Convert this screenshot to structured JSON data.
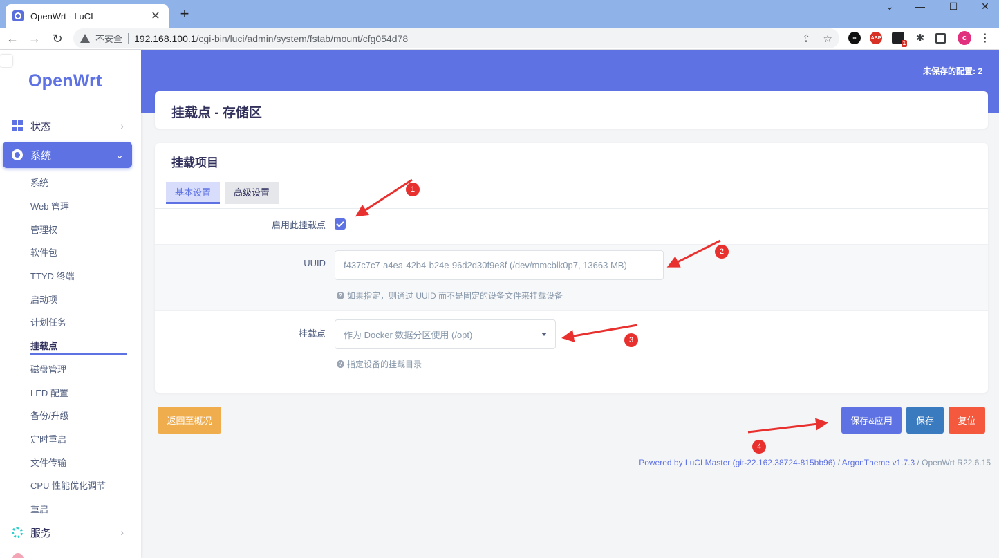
{
  "browser": {
    "tab_title": "OpenWrt - LuCI",
    "insecure_label": "不安全",
    "url_host": "192.168.100.1",
    "url_path": "/cgi-bin/luci/admin/system/fstab/mount/cfg054d78",
    "ext_abp": "ABP",
    "ext_badge": "1",
    "profile_initial": "c"
  },
  "sidebar": {
    "brand": "OpenWrt",
    "status_label": "状态",
    "system_label": "系统",
    "services_label": "服务",
    "sub_items": [
      "系统",
      "Web 管理",
      "管理权",
      "软件包",
      "TTYD 终端",
      "启动项",
      "计划任务",
      "挂载点",
      "磁盘管理",
      "LED 配置",
      "备份/升级",
      "定时重启",
      "文件传输",
      "CPU 性能优化调节",
      "重启"
    ],
    "active_sub": "挂载点"
  },
  "header": {
    "unsaved": "未保存的配置: 2"
  },
  "page": {
    "title": "挂载点 - 存储区",
    "section_title": "挂载项目",
    "tab_basic": "基本设置",
    "tab_advanced": "高级设置",
    "enable_label": "启用此挂载点",
    "enable_checked": true,
    "uuid_label": "UUID",
    "uuid_value": "f437c7c7-a4ea-42b4-b24e-96d2d30f9e8f (/dev/mmcblk0p7, 13663 MB)",
    "uuid_hint": "如果指定，则通过 UUID 而不是固定的设备文件来挂载设备",
    "mount_label": "挂载点",
    "mount_value": "作为 Docker 数据分区使用 (/opt)",
    "mount_hint": "指定设备的挂载目录"
  },
  "actions": {
    "back": "返回至概况",
    "save_apply": "保存&应用",
    "save": "保存",
    "reset": "复位"
  },
  "footer": {
    "powered": "Powered by LuCI Master (git-22.162.38724-815bb96)",
    "sep1": " / ",
    "theme": "ArgonTheme v1.7.3",
    "sep2": " / ",
    "release": "OpenWrt R22.6.15"
  },
  "annotations": [
    "1",
    "2",
    "3",
    "4"
  ],
  "colors": {
    "accent": "#5e72e4",
    "back_button": "#f0ad4e",
    "save_button": "#3a7abf",
    "reset_button": "#f5593d",
    "annotation": "#e8312f"
  }
}
